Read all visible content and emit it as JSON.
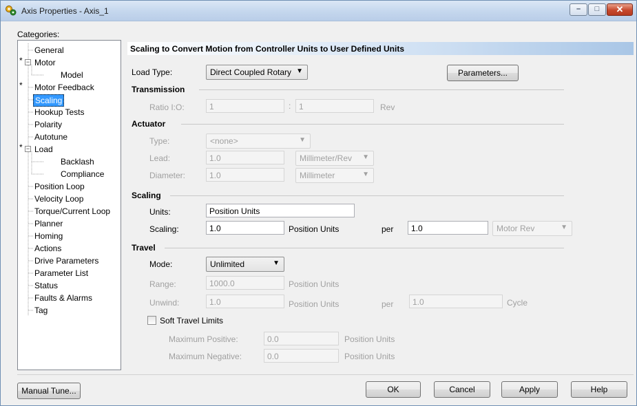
{
  "window": {
    "title": "Axis Properties - Axis_1",
    "controls": {
      "minimize": "–",
      "maximize": "□",
      "close": "✕"
    }
  },
  "categories_label": "Categories:",
  "tree": {
    "items": [
      {
        "label": "General"
      },
      {
        "label": "Motor",
        "star": "*",
        "expander": "−"
      },
      {
        "label": "Model"
      },
      {
        "label": "Motor Feedback",
        "star": "*"
      },
      {
        "label": "Scaling",
        "selected": true
      },
      {
        "label": "Hookup Tests"
      },
      {
        "label": "Polarity"
      },
      {
        "label": "Autotune"
      },
      {
        "label": "Load",
        "star": "*",
        "expander": "−"
      },
      {
        "label": "Backlash"
      },
      {
        "label": "Compliance"
      },
      {
        "label": "Position Loop"
      },
      {
        "label": "Velocity Loop"
      },
      {
        "label": "Torque/Current Loop"
      },
      {
        "label": "Planner"
      },
      {
        "label": "Homing"
      },
      {
        "label": "Actions"
      },
      {
        "label": "Drive Parameters"
      },
      {
        "label": "Parameter List"
      },
      {
        "label": "Status"
      },
      {
        "label": "Faults & Alarms"
      },
      {
        "label": "Tag"
      }
    ]
  },
  "header": "Scaling to Convert Motion from Controller Units to User Defined Units",
  "load_type": {
    "label": "Load Type:",
    "value": "Direct Coupled Rotary",
    "parameters_button": "Parameters..."
  },
  "transmission": {
    "title": "Transmission",
    "ratio_label": "Ratio I:O:",
    "ratio_in": "1",
    "ratio_out": "1",
    "unit": "Rev"
  },
  "actuator": {
    "title": "Actuator",
    "type_label": "Type:",
    "type_value": "<none>",
    "lead_label": "Lead:",
    "lead_value": "1.0",
    "lead_unit": "Millimeter/Rev",
    "diameter_label": "Diameter:",
    "diameter_value": "1.0",
    "diameter_unit": "Millimeter"
  },
  "scaling": {
    "title": "Scaling",
    "units_label": "Units:",
    "units_value": "Position Units",
    "scaling_label": "Scaling:",
    "scaling_value": "1.0",
    "scaling_unit": "Position Units",
    "per_label": "per",
    "per_value": "1.0",
    "per_unit": "Motor Rev"
  },
  "travel": {
    "title": "Travel",
    "mode_label": "Mode:",
    "mode_value": "Unlimited",
    "range_label": "Range:",
    "range_value": "1000.0",
    "range_unit": "Position Units",
    "unwind_label": "Unwind:",
    "unwind_value": "1.0",
    "unwind_unit": "Position Units",
    "unwind_per_label": "per",
    "unwind_per_value": "1.0",
    "unwind_per_unit": "Cycle",
    "soft_limits_label": "Soft Travel Limits",
    "max_pos_label": "Maximum Positive:",
    "max_pos_value": "0.0",
    "max_pos_unit": "Position Units",
    "max_neg_label": "Maximum Negative:",
    "max_neg_value": "0.0",
    "max_neg_unit": "Position Units"
  },
  "footer": {
    "manual_tune": "Manual Tune...",
    "ok": "OK",
    "cancel": "Cancel",
    "apply": "Apply",
    "help": "Help"
  }
}
